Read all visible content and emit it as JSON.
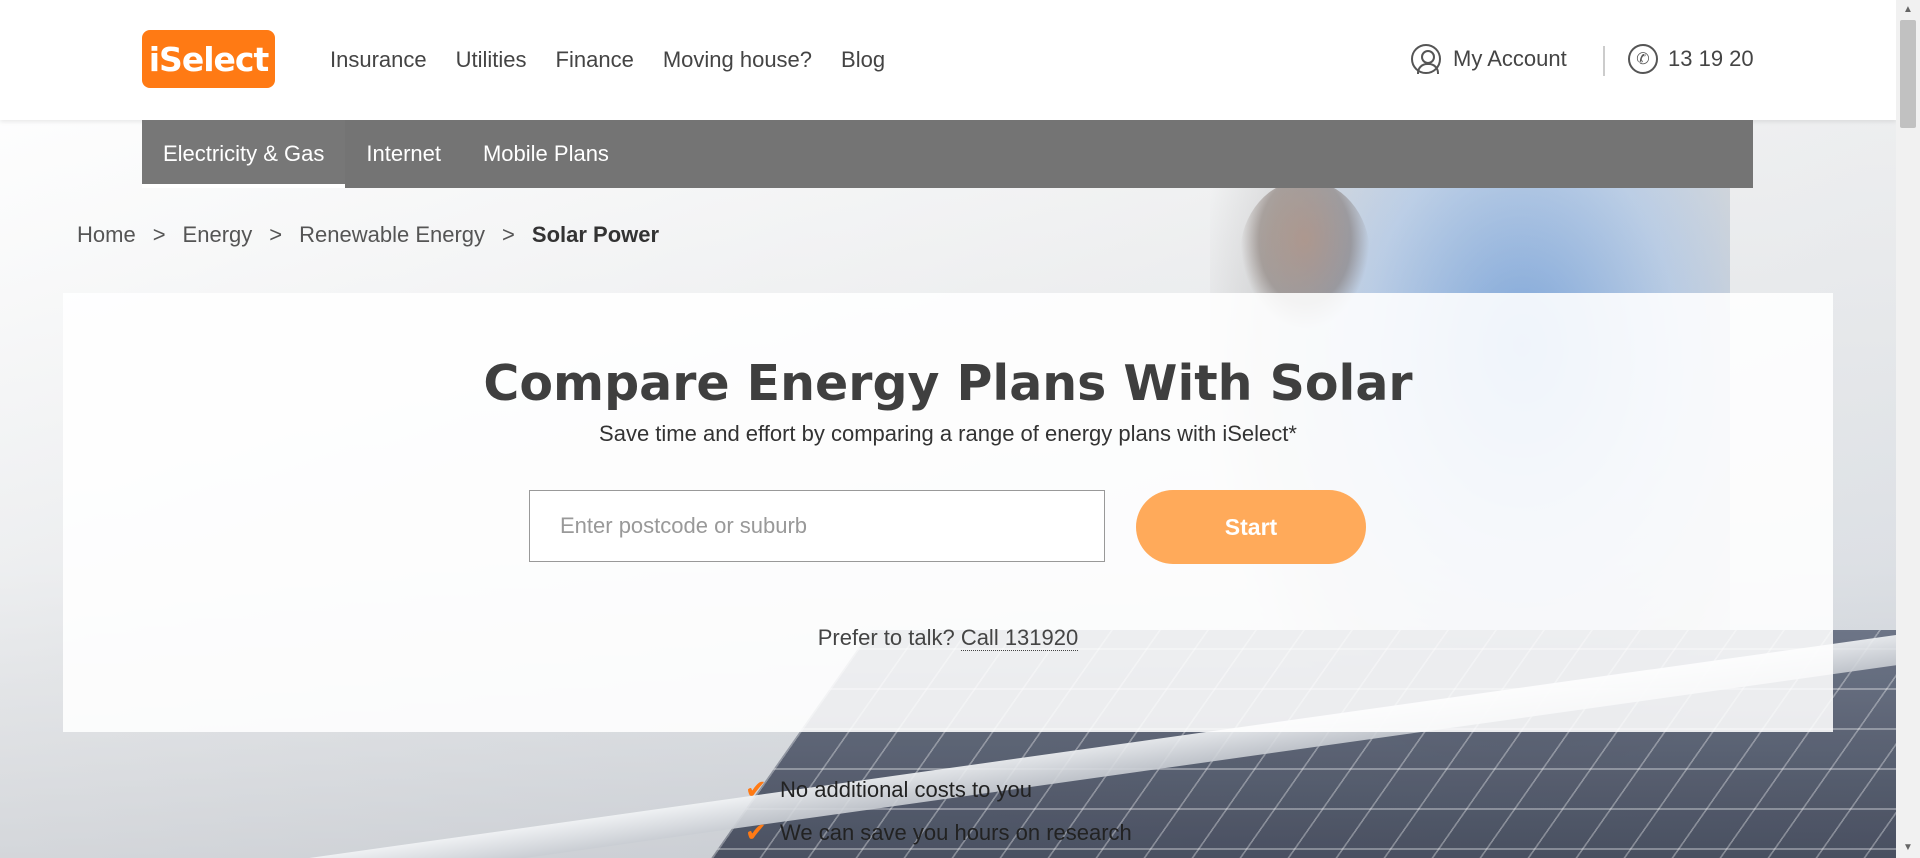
{
  "header": {
    "logo_text": "iSelect",
    "nav": [
      "Insurance",
      "Utilities",
      "Finance",
      "Moving house?",
      "Blog"
    ],
    "account_label": "My Account",
    "phone": "13 19 20"
  },
  "subnav": {
    "items": [
      "Electricity & Gas",
      "Internet",
      "Mobile Plans"
    ],
    "active": "Electricity & Gas"
  },
  "breadcrumb": {
    "items": [
      "Home",
      "Energy",
      "Renewable Energy"
    ],
    "current": "Solar Power",
    "separator": ">"
  },
  "hero": {
    "title": "Compare Energy Plans With Solar",
    "subtitle": "Save time and effort by comparing a range of energy plans with iSelect*",
    "postcode_placeholder": "Enter postcode or suburb",
    "start_label": "Start",
    "talk_prefix": "Prefer to talk?",
    "talk_link": "Call 131920"
  },
  "benefits": [
    "No additional costs to you",
    "We can save you hours on research"
  ],
  "colors": {
    "brand_orange": "#ff7a14",
    "start_button": "#ffaa5a",
    "subnav_bg": "#747474"
  },
  "icons": {
    "account": "user-circle-icon",
    "phone": "phone-icon",
    "check": "check-icon",
    "chevron": "chevron-right-icon"
  }
}
